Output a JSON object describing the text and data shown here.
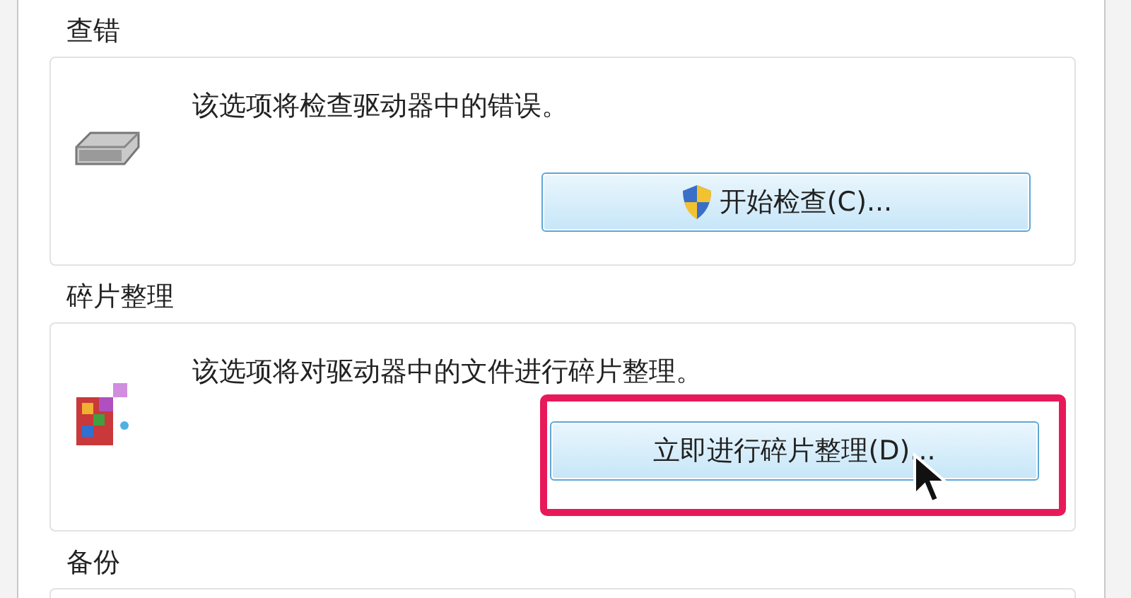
{
  "sections": [
    {
      "title": "查错",
      "kind": "disk",
      "description": "该选项将检查驱动器中的错误。",
      "button": {
        "label": "开始检查(C)...",
        "shield": true
      },
      "highlighted": false
    },
    {
      "title": "碎片整理",
      "kind": "defrag",
      "description": "该选项将对驱动器中的文件进行碎片整理。",
      "button": {
        "label": "立即进行碎片整理(D)...",
        "shield": false
      },
      "highlighted": true
    },
    {
      "title": "备份"
    }
  ]
}
